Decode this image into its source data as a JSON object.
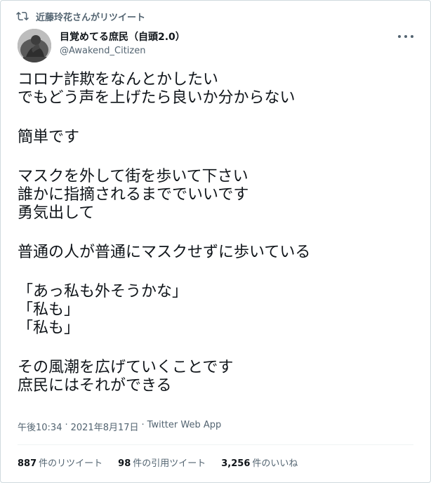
{
  "retweet_banner": "近藤玲花さんがリツイート",
  "author": {
    "display_name": "目覚めてる庶民（自頭2.0）",
    "handle": "@Awakend_Citizen"
  },
  "body_lines": [
    "コロナ詐欺をなんとかしたい",
    "でもどう声を上げたら良いか分からない",
    "",
    "簡単です",
    "",
    "マスクを外して街を歩いて下さい",
    "誰かに指摘されるまででいいです",
    "勇気出して",
    "",
    "普通の人が普通にマスクせずに歩いている",
    "",
    "「あっ私も外そうかな」",
    "「私も」",
    "「私も」",
    "",
    "その風潮を広げていくことです",
    "庶民にはそれができる"
  ],
  "meta": {
    "time": "午後10:34",
    "separator": "·",
    "date": "2021年8月17日",
    "source": "Twitter Web App"
  },
  "stats": {
    "retweets_count": "887",
    "retweets_label": "件のリツイート",
    "quotes_count": "98",
    "quotes_label": "件の引用ツイート",
    "likes_count": "3,256",
    "likes_label": "件のいいね"
  },
  "icons": {
    "retweet": "retweet-icon",
    "more": "more-icon",
    "avatar": "thinker-statue-avatar"
  },
  "colors": {
    "text": "#0f1419",
    "secondary": "#536471",
    "border": "#cfd9de"
  }
}
